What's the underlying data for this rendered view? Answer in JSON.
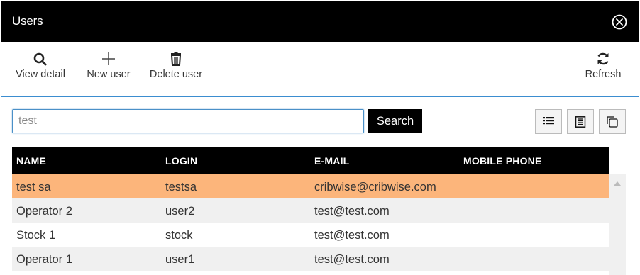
{
  "window": {
    "title": "Users"
  },
  "toolbar": {
    "view_detail": "View detail",
    "new_user": "New user",
    "delete_user": "Delete user",
    "refresh": "Refresh"
  },
  "search": {
    "value": "test",
    "button_label": "Search"
  },
  "table": {
    "columns": [
      "NAME",
      "LOGIN",
      "E-MAIL",
      "MOBILE PHONE"
    ],
    "rows": [
      {
        "name": "test sa",
        "login": "testsa",
        "email": "cribwise@cribwise.com",
        "mobile": ""
      },
      {
        "name": "Operator 2",
        "login": "user2",
        "email": "test@test.com",
        "mobile": ""
      },
      {
        "name": "Stock 1",
        "login": "stock",
        "email": "test@test.com",
        "mobile": ""
      },
      {
        "name": "Operator 1",
        "login": "user1",
        "email": "test@test.com",
        "mobile": ""
      }
    ]
  },
  "colors": {
    "selected_row": "#fcb57b",
    "header_bg": "#000000",
    "accent_border": "#3b8dd0"
  },
  "icons": [
    "close-icon",
    "search-icon",
    "plus-icon",
    "trash-icon",
    "refresh-icon",
    "list-view-icon",
    "detail-view-icon",
    "copy-icon",
    "scroll-up-icon"
  ]
}
